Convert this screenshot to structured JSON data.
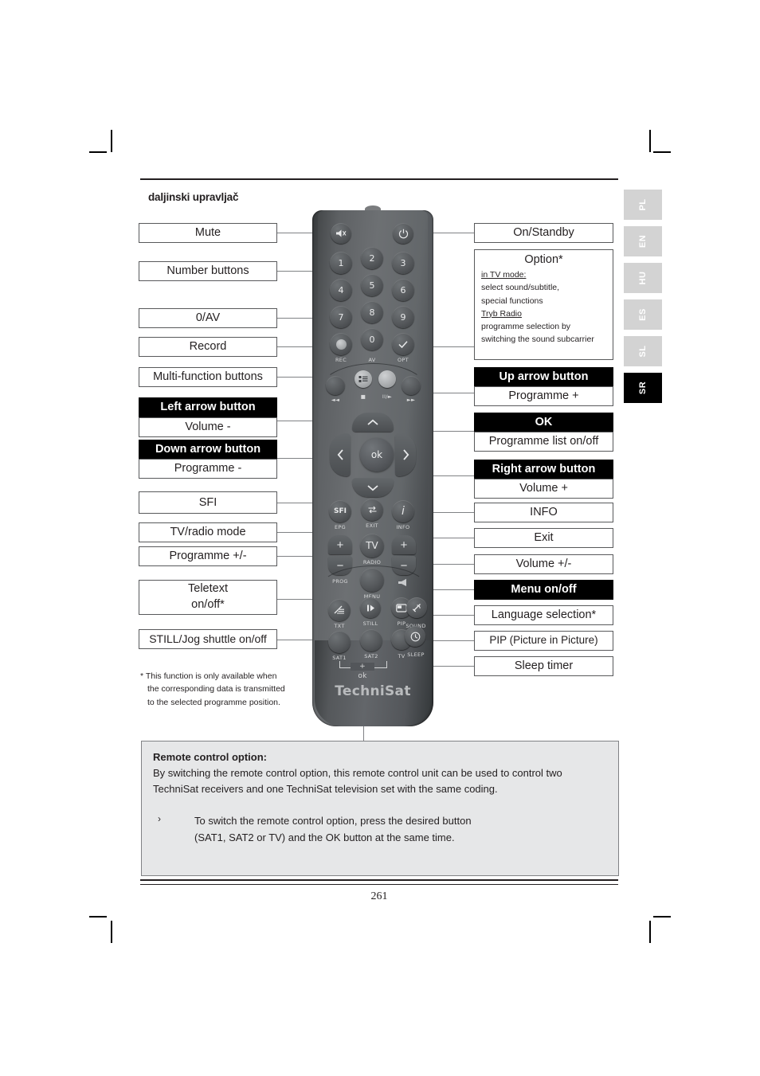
{
  "document": {
    "section_title": "daljinski upravljač",
    "page_number": "261"
  },
  "language_tabs": [
    {
      "code": "PL",
      "active": false
    },
    {
      "code": "EN",
      "active": false
    },
    {
      "code": "HU",
      "active": false
    },
    {
      "code": "ES",
      "active": false
    },
    {
      "code": "SL",
      "active": false
    },
    {
      "code": "SR",
      "active": true
    }
  ],
  "left_labels": {
    "mute": "Mute",
    "number_buttons": "Number buttons",
    "zero_av": "0/AV",
    "record": "Record",
    "multi_function": "Multi-function buttons",
    "left_arrow_title": "Left arrow button",
    "left_arrow_sub": "Volume -",
    "down_arrow_title": "Down arrow button",
    "down_arrow_sub": "Programme -",
    "sfi": "SFI",
    "tv_radio_mode": "TV/radio mode",
    "programme_plus_minus": "Programme +/-",
    "teletext_l1": "Teletext",
    "teletext_l2": "on/off*",
    "still_jog": "STILL/Jog shuttle on/off"
  },
  "right_labels": {
    "on_standby": "On/Standby",
    "option_title": "Option*",
    "option_lines": [
      {
        "text": "in TV mode:",
        "underline": true
      },
      {
        "text": "select sound/subtitle,",
        "underline": false
      },
      {
        "text": "special functions",
        "underline": false
      },
      {
        "text": "Tryb Radio",
        "underline": true
      },
      {
        "text": "programme selection by",
        "underline": false
      },
      {
        "text": "switching the sound subcarrier",
        "underline": false
      }
    ],
    "up_arrow_title": "Up arrow button",
    "up_arrow_sub": "Programme +",
    "ok_title": "OK",
    "ok_sub": "Programme list on/off",
    "right_arrow_title": "Right arrow button",
    "right_arrow_sub": "Volume +",
    "info": "INFO",
    "exit": "Exit",
    "volume_plus_minus": "Volume +/-",
    "menu_on_off": "Menu on/off",
    "language_selection": "Language selection*",
    "pip": "PIP (Picture in Picture)",
    "sleep_timer": "Sleep timer"
  },
  "footnote": {
    "line1": "* This function is only available when",
    "line2": "the corresponding data is transmitted",
    "line3": "to the selected programme position."
  },
  "remote_control_option": {
    "title": "Remote control option:",
    "paragraph_l1": "By switching the remote control option, this remote control unit can be used to control two",
    "paragraph_l2": "TechniSat receivers and one TechniSat television set with the same coding.",
    "bullet_marker": "›",
    "bullet_l1": "To switch the remote control option, press the desired button",
    "bullet_l2": "(SAT1, SAT2 or TV) and the OK button at the same time."
  },
  "remote": {
    "brand": "TechniSat",
    "keys": {
      "mute": "mute-icon",
      "power": "power-icon",
      "n1": "1",
      "n2": "2",
      "n3": "3",
      "n4": "4",
      "n5": "5",
      "n6": "6",
      "n7": "7",
      "n8": "8",
      "n9": "9",
      "n0": "0",
      "rec_caption": "REC",
      "av_caption": "AV",
      "opt_caption": "OPT",
      "rew_caption": "◄◄",
      "stop_caption": "■",
      "play_caption": "II/►",
      "ff_caption": "►►",
      "ok": "ok",
      "sfi": "SFI",
      "epg_caption": "EPG",
      "exit_caption": "EXIT",
      "info_glyph": "i",
      "info_caption": "INFO",
      "tv": "TV",
      "radio_caption": "RADIO",
      "prog_caption": "PROG",
      "menu_caption": "MENU",
      "plus": "+",
      "minus": "−",
      "txt_caption": "TXT",
      "still_caption": "STILL",
      "pip_caption": "PIP",
      "sound_caption": "SOUND",
      "sat1_caption": "SAT1",
      "sat2_caption": "SAT2",
      "tv_caption": "TV",
      "sleep_caption": "SLEEP",
      "ok_combo_plus": "+",
      "ok_combo_label": "ok"
    }
  }
}
